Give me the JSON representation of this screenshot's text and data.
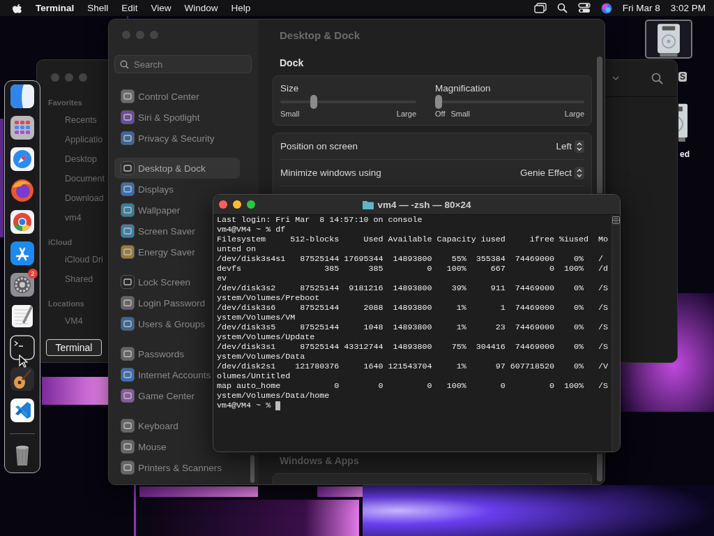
{
  "menu_bar": {
    "app_name": "Terminal",
    "menus": [
      "Shell",
      "Edit",
      "View",
      "Window",
      "Help"
    ],
    "date": "Fri Mar 8",
    "time": "3:02 PM"
  },
  "desktop_icons": [
    {
      "label": "S",
      "selected": true
    },
    {
      "label": "ed",
      "selected": false
    }
  ],
  "finder_window": {
    "sidebar": [
      {
        "heading": "Favorites",
        "items": [
          "Recents",
          "Applicatio",
          "Desktop",
          "Document",
          "Download",
          "vm4"
        ]
      },
      {
        "heading": "iCloud",
        "items": [
          "iCloud Dri",
          "Shared"
        ]
      },
      {
        "heading": "Locations",
        "items": [
          "VM4"
        ]
      }
    ]
  },
  "settings_window": {
    "search": {
      "placeholder": "Search"
    },
    "sidebar_groups": [
      [
        {
          "label": "Control Center",
          "color": "#6b6b70",
          "selected": false
        },
        {
          "label": "Siri & Spotlight",
          "color": "#6a4f9a",
          "selected": false
        },
        {
          "label": "Privacy & Security",
          "color": "#3d6797",
          "selected": false
        }
      ],
      [
        {
          "label": "Desktop & Dock",
          "color": "#2c2c2e",
          "selected": true
        },
        {
          "label": "Displays",
          "color": "#3b6fb0",
          "selected": false
        },
        {
          "label": "Wallpaper",
          "color": "#3a7f9a",
          "selected": false
        },
        {
          "label": "Screen Saver",
          "color": "#3f7fa3",
          "selected": false
        },
        {
          "label": "Energy Saver",
          "color": "#9a7a3f",
          "selected": false
        }
      ],
      [
        {
          "label": "Lock Screen",
          "color": "#262626",
          "selected": false
        },
        {
          "label": "Login Password",
          "color": "#66666a",
          "selected": false
        },
        {
          "label": "Users & Groups",
          "color": "#3d6797",
          "selected": false
        }
      ],
      [
        {
          "label": "Passwords",
          "color": "#66666a",
          "selected": false
        },
        {
          "label": "Internet Accounts",
          "color": "#3b6fb0",
          "selected": false
        },
        {
          "label": "Game Center",
          "color": "#8a5aa0",
          "selected": false
        }
      ],
      [
        {
          "label": "Keyboard",
          "color": "#66666a",
          "selected": false
        },
        {
          "label": "Mouse",
          "color": "#66666a",
          "selected": false
        },
        {
          "label": "Printers & Scanners",
          "color": "#66666a",
          "selected": false
        }
      ]
    ],
    "title": "Desktop & Dock",
    "section": "Dock",
    "sliders": [
      {
        "label": "Size",
        "level": 0.23,
        "marks": [
          "Small",
          "Large"
        ]
      },
      {
        "label": "Magnification",
        "level": 0,
        "marks": [
          "Off",
          "Small",
          "Large"
        ]
      }
    ],
    "rows": [
      {
        "label": "Position on screen",
        "value": "Left"
      },
      {
        "label": "Minimize windows using",
        "value": "Genie Effect"
      }
    ],
    "next_section": "Windows & Apps"
  },
  "terminal": {
    "title": "vm4 — -zsh — 80×24",
    "lines": [
      "Last login: Fri Mar  8 14:57:10 on console",
      "vm4@VM4 ~ % df",
      "Filesystem     512-blocks     Used Available Capacity iused     ifree %iused  Mo",
      "unted on",
      "/dev/disk3s4s1   87525144 17695344  14893800    55%  355384  74469000    0%   /",
      "devfs                 385      385         0   100%     667         0  100%   /d",
      "ev",
      "/dev/disk3s2     87525144  9181216  14893800    39%     911  74469000    0%   /S",
      "ystem/Volumes/Preboot",
      "/dev/disk3s6     87525144     2088  14893800     1%       1  74469000    0%   /S",
      "ystem/Volumes/VM",
      "/dev/disk3s5     87525144     1048  14893800     1%      23  74469000    0%   /S",
      "ystem/Volumes/Update",
      "/dev/disk3s1     87525144 43312744  14893800    75%  304416  74469000    0%   /S",
      "ystem/Volumes/Data",
      "/dev/disk2s1    121780376     1640 121543704     1%      97 607718520    0%   /V",
      "olumes/Untitled",
      "map auto_home           0        0         0   100%       0         0  100%   /S",
      "ystem/Volumes/Data/home"
    ],
    "prompt": "vm4@VM4 ~ %"
  },
  "dock": {
    "apps": [
      {
        "kind": "finder"
      },
      {
        "kind": "launchpad"
      },
      {
        "kind": "safari"
      },
      {
        "kind": "firefox"
      },
      {
        "kind": "chrome"
      },
      {
        "kind": "appstore"
      },
      {
        "kind": "settings",
        "badge": "2"
      },
      {
        "kind": "textedit"
      },
      {
        "kind": "terminal"
      },
      {
        "kind": "garageband"
      },
      {
        "kind": "vscode"
      },
      {
        "kind": "trash"
      }
    ]
  },
  "tooltip": "Terminal"
}
